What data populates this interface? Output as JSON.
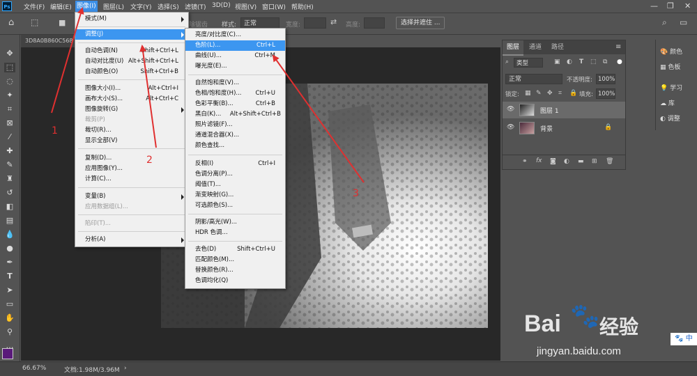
{
  "menubar": {
    "items": [
      "文件(F)",
      "编辑(E)",
      "图像(I)",
      "图层(L)",
      "文字(Y)",
      "选择(S)",
      "滤镜(T)",
      "3D(D)",
      "视图(V)",
      "窗口(W)",
      "帮助(H)"
    ]
  },
  "options": {
    "style_label": "样式:",
    "style_value": "正常",
    "width_label": "宽度:",
    "height_label": "高度:",
    "select_mask_button": "选择并遮住 ...",
    "feather_label": "消除锯齿"
  },
  "document": {
    "tab_title": "3D8A0B860C568"
  },
  "image_menu": {
    "items": [
      {
        "label": "模式(M)",
        "shortcut": "",
        "submenu": true,
        "disabled": false
      },
      {
        "label": "调整(J)",
        "shortcut": "",
        "submenu": true,
        "disabled": false
      },
      {
        "label": "自动色调(N)",
        "shortcut": "Shift+Ctrl+L",
        "submenu": false,
        "disabled": false
      },
      {
        "label": "自动对比度(U)",
        "shortcut": "Alt+Shift+Ctrl+L",
        "submenu": false,
        "disabled": false
      },
      {
        "label": "自动颜色(O)",
        "shortcut": "Shift+Ctrl+B",
        "submenu": false,
        "disabled": false
      },
      {
        "label": "图像大小(I)...",
        "shortcut": "Alt+Ctrl+I",
        "submenu": false,
        "disabled": false
      },
      {
        "label": "画布大小(S)...",
        "shortcut": "Alt+Ctrl+C",
        "submenu": false,
        "disabled": false
      },
      {
        "label": "图像旋转(G)",
        "shortcut": "",
        "submenu": true,
        "disabled": false
      },
      {
        "label": "裁剪(P)",
        "shortcut": "",
        "submenu": false,
        "disabled": true
      },
      {
        "label": "裁切(R)...",
        "shortcut": "",
        "submenu": false,
        "disabled": false
      },
      {
        "label": "显示全部(V)",
        "shortcut": "",
        "submenu": false,
        "disabled": false
      },
      {
        "label": "复制(D)...",
        "shortcut": "",
        "submenu": false,
        "disabled": false
      },
      {
        "label": "应用图像(Y)...",
        "shortcut": "",
        "submenu": false,
        "disabled": false
      },
      {
        "label": "计算(C)...",
        "shortcut": "",
        "submenu": false,
        "disabled": false
      },
      {
        "label": "变量(B)",
        "shortcut": "",
        "submenu": true,
        "disabled": false
      },
      {
        "label": "应用数据组(L)...",
        "shortcut": "",
        "submenu": false,
        "disabled": true
      },
      {
        "label": "陷印(T)...",
        "shortcut": "",
        "submenu": false,
        "disabled": true
      },
      {
        "label": "分析(A)",
        "shortcut": "",
        "submenu": true,
        "disabled": false
      }
    ]
  },
  "adjust_menu": {
    "items": [
      {
        "label": "亮度/对比度(C)...",
        "shortcut": ""
      },
      {
        "label": "色阶(L)...",
        "shortcut": "Ctrl+L"
      },
      {
        "label": "曲线(U)...",
        "shortcut": "Ctrl+M"
      },
      {
        "label": "曝光度(E)...",
        "shortcut": ""
      },
      {
        "label": "自然饱和度(V)...",
        "shortcut": ""
      },
      {
        "label": "色相/饱和度(H)...",
        "shortcut": "Ctrl+U"
      },
      {
        "label": "色彩平衡(B)...",
        "shortcut": "Ctrl+B"
      },
      {
        "label": "黑白(K)...",
        "shortcut": "Alt+Shift+Ctrl+B"
      },
      {
        "label": "照片滤镜(F)...",
        "shortcut": ""
      },
      {
        "label": "通道混合器(X)...",
        "shortcut": ""
      },
      {
        "label": "颜色查找...",
        "shortcut": ""
      },
      {
        "label": "反相(I)",
        "shortcut": "Ctrl+I"
      },
      {
        "label": "色调分离(P)...",
        "shortcut": ""
      },
      {
        "label": "阈值(T)...",
        "shortcut": ""
      },
      {
        "label": "渐变映射(G)...",
        "shortcut": ""
      },
      {
        "label": "可选颜色(S)...",
        "shortcut": ""
      },
      {
        "label": "阴影/高光(W)...",
        "shortcut": ""
      },
      {
        "label": "HDR 色调...",
        "shortcut": ""
      },
      {
        "label": "去色(D)",
        "shortcut": "Shift+Ctrl+U"
      },
      {
        "label": "匹配颜色(M)...",
        "shortcut": ""
      },
      {
        "label": "替换颜色(R)...",
        "shortcut": ""
      },
      {
        "label": "色调均化(Q)",
        "shortcut": ""
      }
    ]
  },
  "layers_panel": {
    "tabs": [
      "图层",
      "通道",
      "路径"
    ],
    "filter_kind": "类型",
    "blend_mode": "正常",
    "opacity_label": "不透明度:",
    "opacity_value": "100%",
    "lock_label": "锁定:",
    "fill_label": "填充:",
    "fill_value": "100%",
    "layers": [
      {
        "name": "图层 1",
        "selected": true
      },
      {
        "name": "背景",
        "selected": false
      }
    ]
  },
  "right_panel": {
    "items": [
      "颜色",
      "色板",
      "学习",
      "库",
      "调整"
    ]
  },
  "status": {
    "zoom": "66.67%",
    "doc_info": "文档:1.98M/3.96M"
  },
  "annotations": [
    "1",
    "2",
    "3"
  ],
  "watermark": {
    "brand": "Bai",
    "brand_cn": "经验",
    "url": "jingyan.baidu.com"
  },
  "colors": {
    "highlight": "#3c96f0",
    "arrow": "#e03030",
    "foreground_swatch": "#5a1a7a"
  }
}
